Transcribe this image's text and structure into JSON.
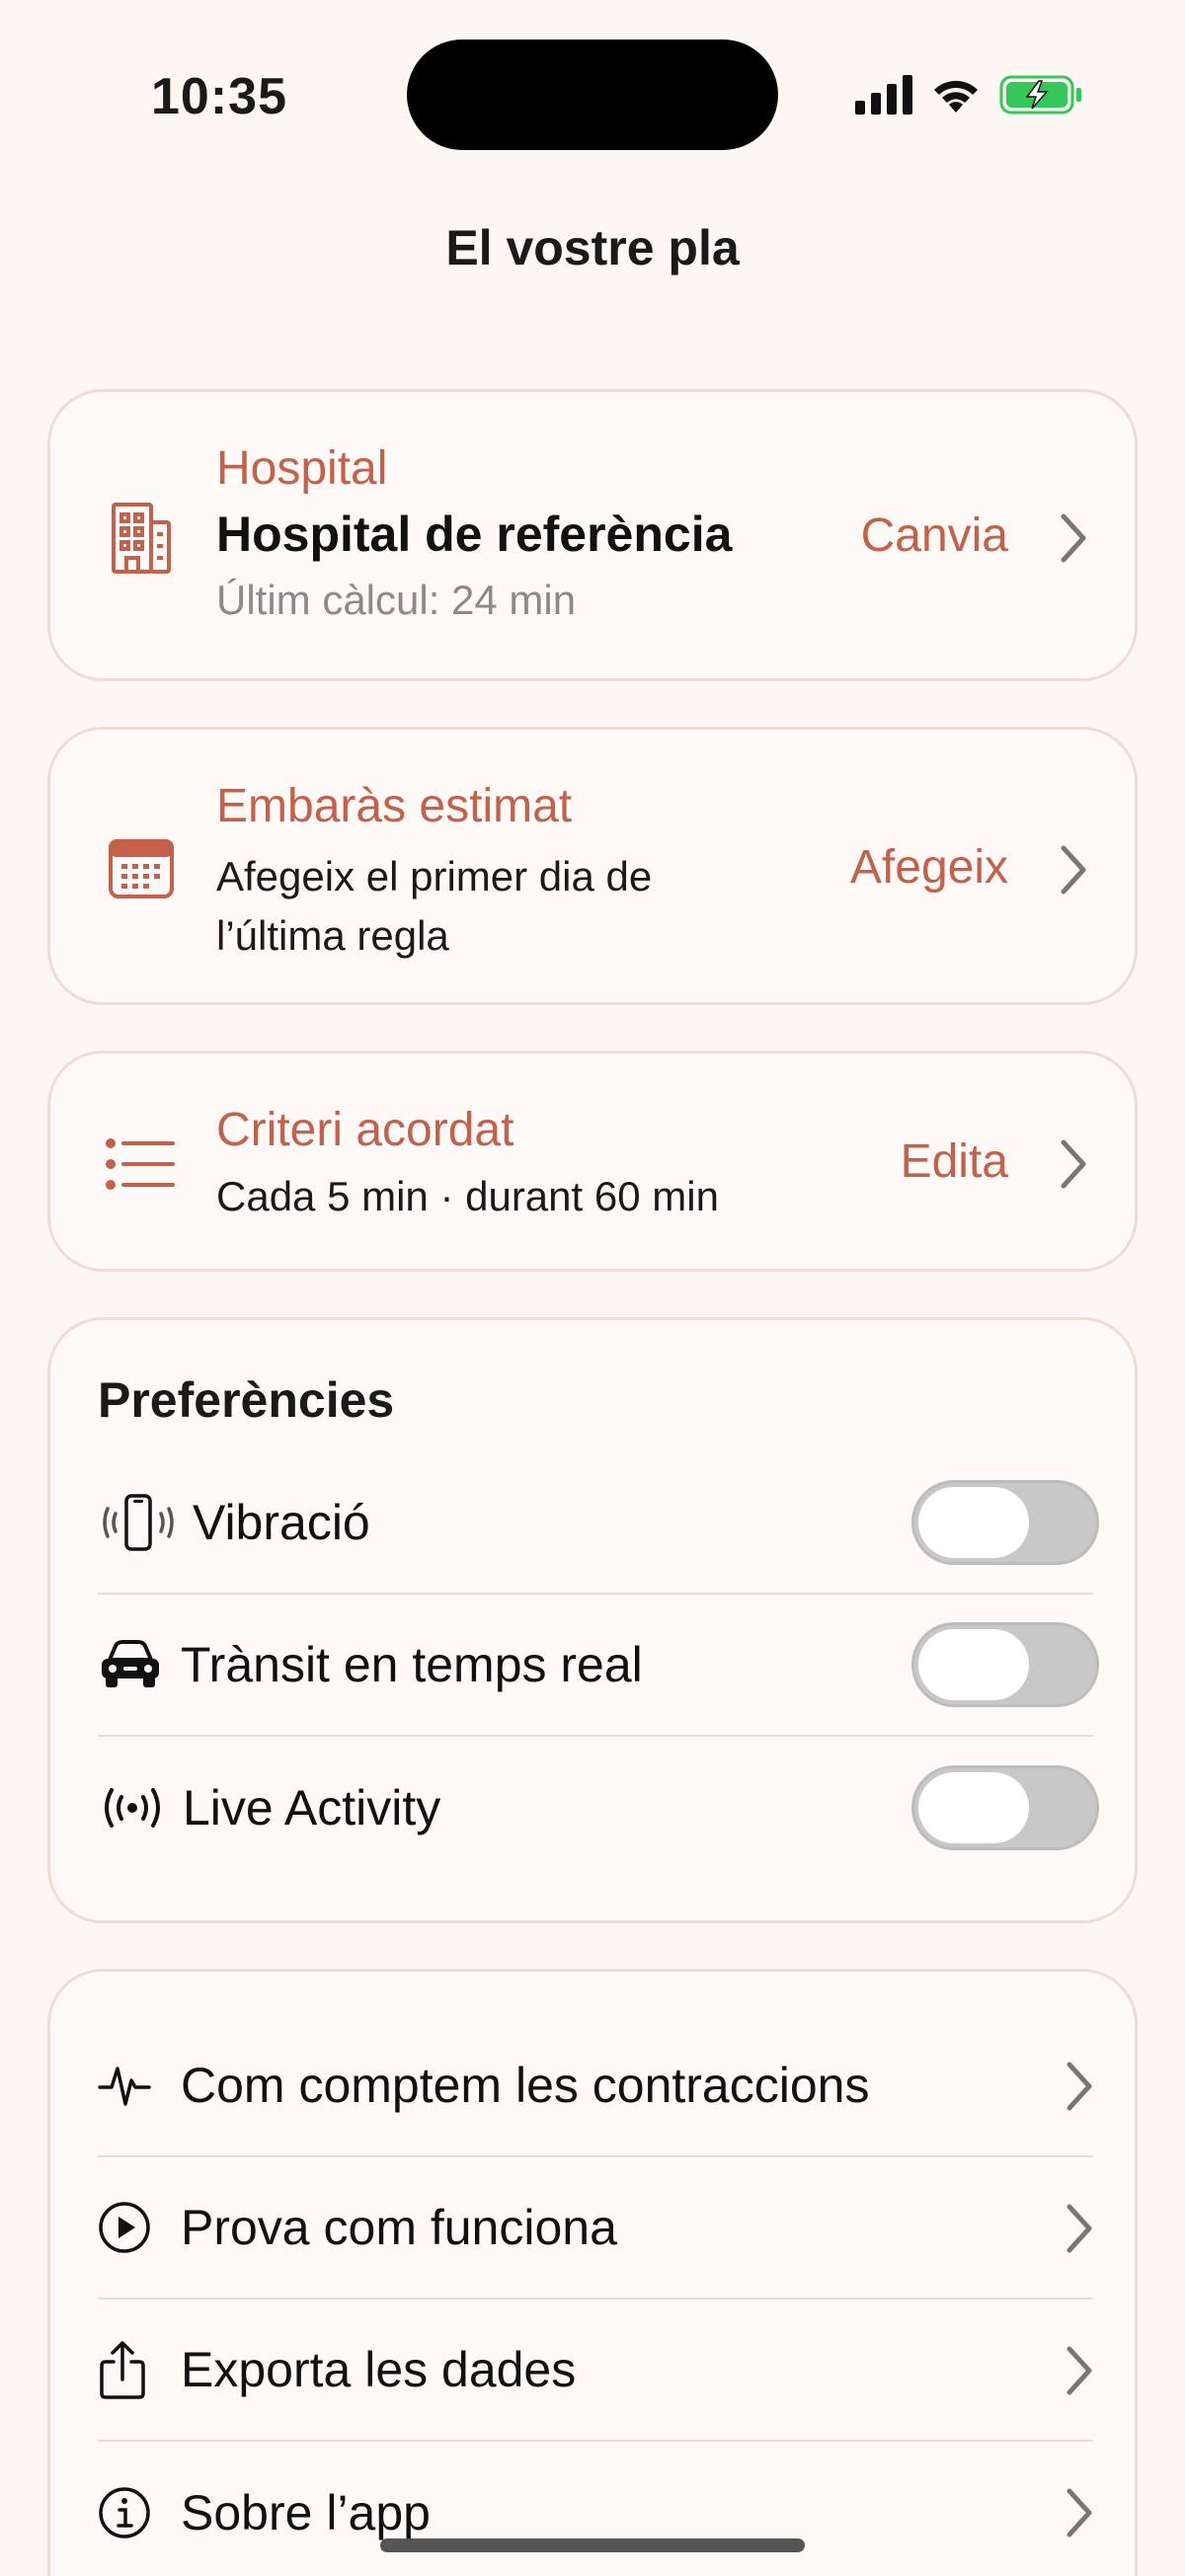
{
  "status": {
    "time": "10:35"
  },
  "nav": {
    "title": "El vostre pla"
  },
  "hospital": {
    "kicker": "Hospital",
    "title": "Hospital de referència",
    "subtitle": "Últim càlcul: 24 min",
    "action": "Canvia",
    "icon": "building-icon"
  },
  "pregnancy": {
    "kicker": "Embaràs estimat",
    "line1": "Afegeix el primer dia de",
    "line2": "l’última regla",
    "action": "Afegeix",
    "icon": "calendar-icon"
  },
  "criteria": {
    "kicker": "Criteri acordat",
    "subtitle": "Cada 5 min · durant 60 min",
    "action": "Edita",
    "icon": "list-icon"
  },
  "preferences": {
    "title": "Preferències",
    "items": [
      {
        "label": "Vibració",
        "icon": "phone-vibrate-icon",
        "on": false
      },
      {
        "label": "Trànsit en temps real",
        "icon": "car-icon",
        "on": false
      },
      {
        "label": "Live Activity",
        "icon": "broadcast-icon",
        "on": false
      }
    ]
  },
  "links": [
    {
      "label": "Com comptem les contraccions",
      "icon": "waveform-icon"
    },
    {
      "label": "Prova com funciona",
      "icon": "play-circle-icon"
    },
    {
      "label": "Exporta les dades",
      "icon": "share-icon"
    },
    {
      "label": "Sobre l’app",
      "icon": "info-icon"
    }
  ],
  "colors": {
    "accent": "#c4614a",
    "background": "#fdf7f4",
    "card_border": "#efdcd6",
    "toggle_off": "#c8c8c8"
  }
}
